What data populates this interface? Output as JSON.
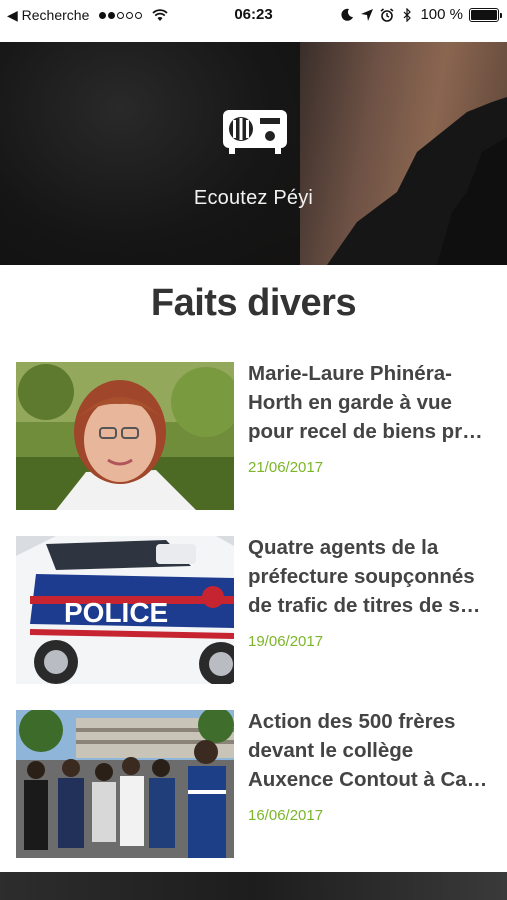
{
  "status_bar": {
    "back_label": "◀ Recherche",
    "time": "06:23",
    "battery_text": "100 %",
    "battery_level": 1.0,
    "signal_filled": 2,
    "signal_total": 5
  },
  "hero": {
    "label": "Ecoutez Péyi",
    "icon": "radio-icon"
  },
  "section": {
    "title": "Faits divers"
  },
  "articles": [
    {
      "title": "Marie-Laure Phinéra-Horth en garde à vue pour recel de biens pr…",
      "date": "21/06/2017"
    },
    {
      "title": "Quatre agents de la préfecture soupçonnés de trafic de titres de s…",
      "date": "19/06/2017",
      "thumb_text": "POLICE"
    },
    {
      "title": "Action des 500 frères devant le collège Auxence Contout à Ca…",
      "date": "16/06/2017"
    }
  ],
  "colors": {
    "date_green": "#7cb52a",
    "title_gray": "#444444"
  }
}
